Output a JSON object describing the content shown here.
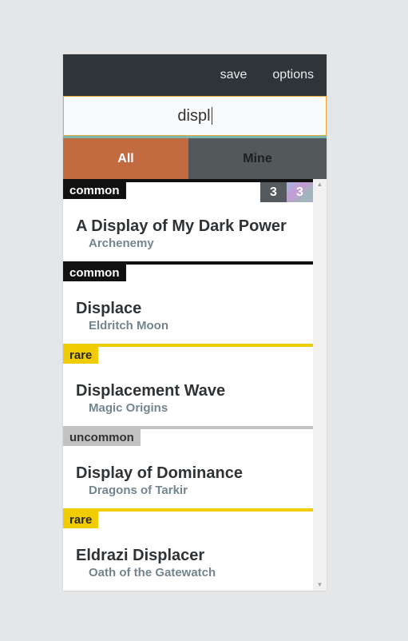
{
  "toolbar": {
    "save_label": "save",
    "options_label": "options"
  },
  "search": {
    "value": "displ"
  },
  "tabs": [
    {
      "label": "All",
      "active": true
    },
    {
      "label": "Mine",
      "active": false
    }
  ],
  "results": [
    {
      "rarity": "common",
      "name": "A Display of My Dark Power",
      "set": "Archenemy"
    },
    {
      "rarity": "common",
      "name": "Displace",
      "set": "Eldritch Moon"
    },
    {
      "rarity": "rare",
      "name": "Displacement Wave",
      "set": "Magic Origins"
    },
    {
      "rarity": "uncommon",
      "name": "Display of Dominance",
      "set": "Dragons of Tarkir"
    },
    {
      "rarity": "rare",
      "name": "Eldrazi Displacer",
      "set": "Oath of the Gatewatch"
    }
  ],
  "first_card_counts": {
    "regular": "3",
    "foil": "3"
  },
  "colors": {
    "accent": "#c26a40",
    "topbar": "#2e3437",
    "rare": "#f1cc00",
    "uncommon": "#c2c2c2",
    "common": "#111111"
  }
}
